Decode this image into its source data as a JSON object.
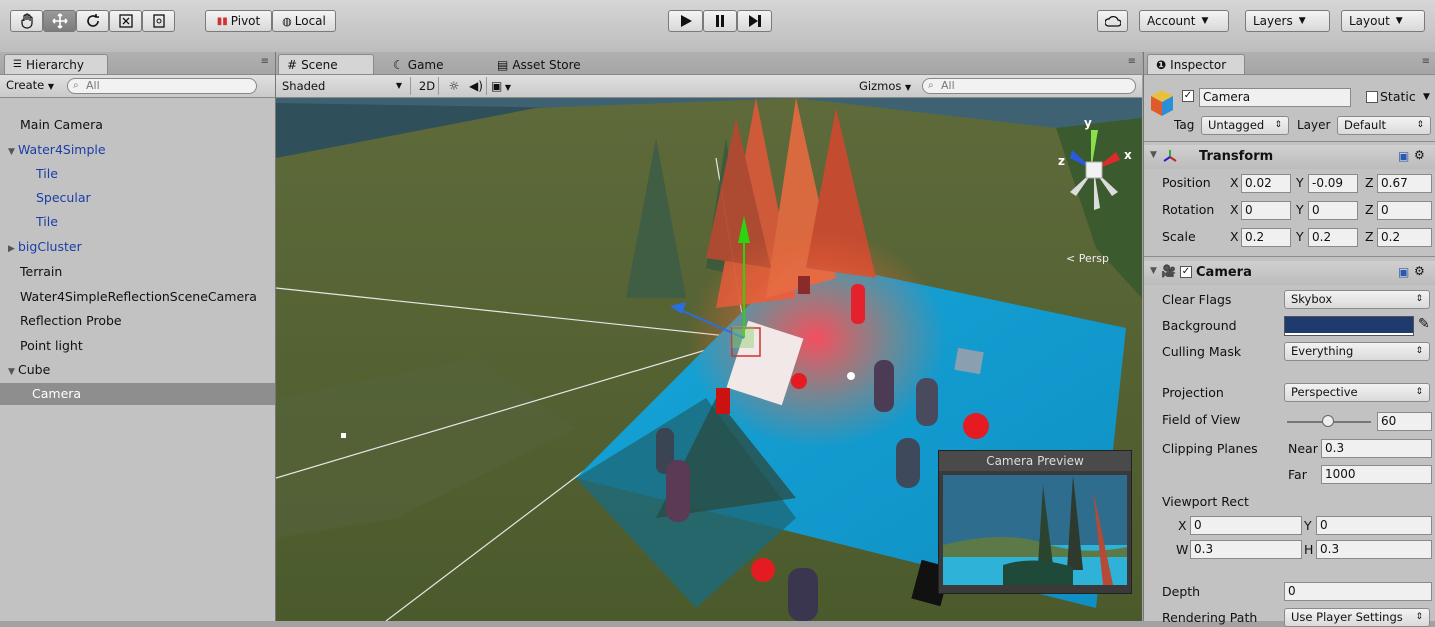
{
  "toolbar": {
    "pivot_label": "Pivot",
    "local_label": "Local",
    "account_label": "Account",
    "layers_label": "Layers",
    "layout_label": "Layout"
  },
  "hierarchy": {
    "tab_label": "Hierarchy",
    "create_label": "Create",
    "search_placeholder": "All",
    "items": [
      {
        "label": "Main Camera"
      },
      {
        "label": "Water4Simple"
      },
      {
        "label": "Tile"
      },
      {
        "label": "Specular"
      },
      {
        "label": "Tile"
      },
      {
        "label": "bigCluster"
      },
      {
        "label": "Terrain"
      },
      {
        "label": "Water4SimpleReflectionSceneCamera"
      },
      {
        "label": "Reflection Probe"
      },
      {
        "label": "Point light"
      },
      {
        "label": "Cube"
      },
      {
        "label": "Camera"
      }
    ]
  },
  "scene": {
    "tabs": [
      "Scene",
      "Game",
      "Asset Store"
    ],
    "shading_mode": "Shaded",
    "mode_2d": "2D",
    "gizmos_label": "Gizmos",
    "search_placeholder": "All",
    "persp_label": "< Persp",
    "gizmo_axes": {
      "y": "y",
      "x": "x",
      "z": "z"
    },
    "camera_preview_title": "Camera Preview"
  },
  "inspector": {
    "tab_label": "Inspector",
    "object_name": "Camera",
    "static_label": "Static",
    "tag_label": "Tag",
    "tag_value": "Untagged",
    "layer_label": "Layer",
    "layer_value": "Default",
    "transform": {
      "title": "Transform",
      "position_label": "Position",
      "rotation_label": "Rotation",
      "scale_label": "Scale",
      "position": {
        "x": "0.02",
        "y": "-0.09",
        "z": "0.67"
      },
      "rotation": {
        "x": "0",
        "y": "0",
        "z": "0"
      },
      "scale": {
        "x": "0.2",
        "y": "0.2",
        "z": "0.2"
      }
    },
    "camera": {
      "title": "Camera",
      "clear_flags_label": "Clear Flags",
      "clear_flags_value": "Skybox",
      "background_label": "Background",
      "background_color": "#1f3a6e",
      "culling_mask_label": "Culling Mask",
      "culling_mask_value": "Everything",
      "projection_label": "Projection",
      "projection_value": "Perspective",
      "fov_label": "Field of View",
      "fov_value": "60",
      "clipping_label": "Clipping Planes",
      "near_label": "Near",
      "near_value": "0.3",
      "far_label": "Far",
      "far_value": "1000",
      "viewport_label": "Viewport Rect",
      "vp_x_label": "X",
      "vp_x": "0",
      "vp_y_label": "Y",
      "vp_y": "0",
      "vp_w_label": "W",
      "vp_w": "0.3",
      "vp_h_label": "H",
      "vp_h": "0.3",
      "depth_label": "Depth",
      "depth_value": "0",
      "rendering_path_label": "Rendering Path",
      "rendering_path_value": "Use Player Settings"
    }
  }
}
